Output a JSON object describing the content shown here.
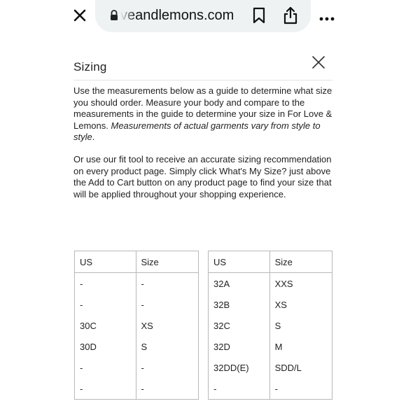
{
  "browser": {
    "url_text": "veandlemons.com",
    "icons": [
      "close-icon",
      "lock-icon",
      "bookmark-icon",
      "share-icon",
      "more-icon"
    ]
  },
  "modal": {
    "title": "Sizing",
    "para1_text": "Use the measurements below as a guide to determine what size you should order. Measure your body and compare to the measurements in the guide to determine your size in For Love & Lemons. ",
    "para1_italic": "Measurements of actual garments vary from style to style",
    "para1_end": ".",
    "para2": "Or use our fit tool to receive an accurate sizing recommendation on every product page. Simply click What's My Size? just above the Add to Cart button on any product page to find your size that will be applied throughout your shopping experience."
  },
  "table_left": {
    "headers": [
      "US",
      "Size"
    ],
    "rows": [
      [
        "-",
        "-"
      ],
      [
        "-",
        "-"
      ],
      [
        "30C",
        "XS"
      ],
      [
        "30D",
        "S"
      ],
      [
        "-",
        "-"
      ],
      [
        "-",
        "-"
      ]
    ]
  },
  "table_right": {
    "headers": [
      "US",
      "Size"
    ],
    "rows": [
      [
        "32A",
        "XXS"
      ],
      [
        "32B",
        "XS"
      ],
      [
        "32C",
        "S"
      ],
      [
        "32D",
        "M"
      ],
      [
        "32DD(E)",
        "SDD/L"
      ],
      [
        "-",
        "-"
      ]
    ]
  }
}
